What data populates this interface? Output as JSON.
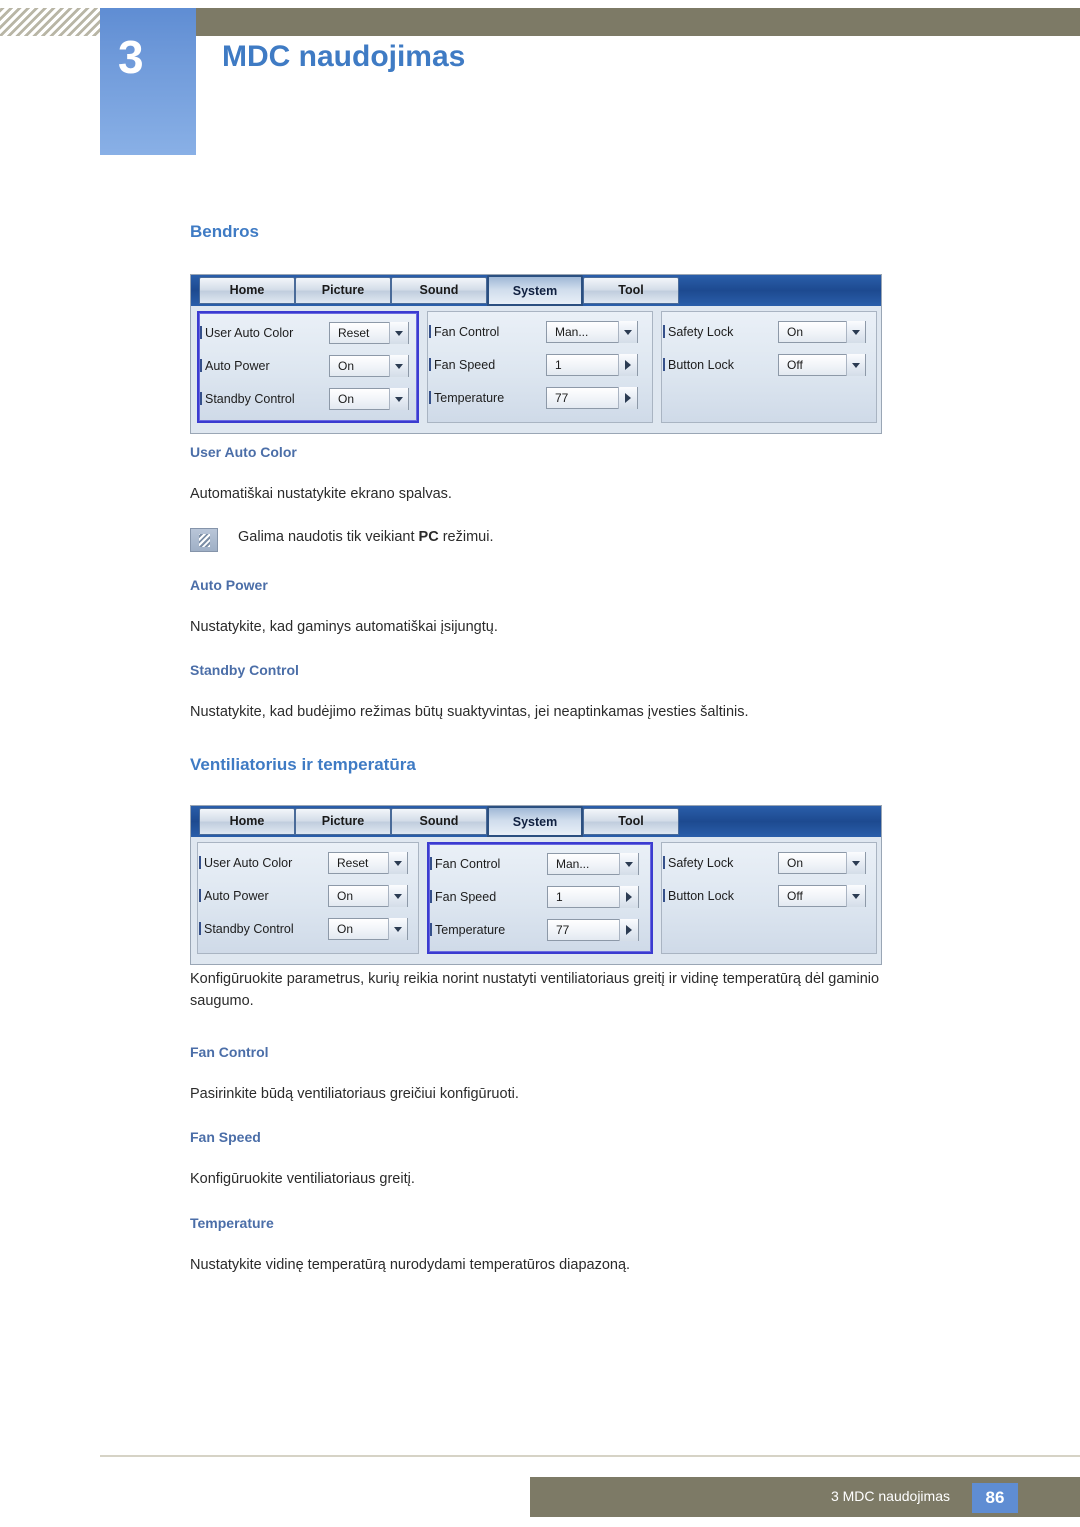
{
  "header": {
    "chapter_number": "3",
    "chapter_title": "MDC naudojimas"
  },
  "sections": [
    {
      "heading": "Bendros",
      "subsections": [
        {
          "title": "User Auto Color",
          "body": "Automatiškai nustatykite ekrano spalvas."
        },
        {
          "title": "Auto Power",
          "body": "Nustatykite, kad gaminys automatiškai įsijungtų."
        },
        {
          "title": "Standby Control",
          "body": "Nustatykite, kad budėjimo režimas būtų suaktyvintas, jei neaptinkamas įvesties šaltinis."
        }
      ],
      "note": {
        "text_before": "Galima naudotis tik veikiant ",
        "bold": "PC",
        "text_after": " režimui.",
        "icon": "note-icon"
      }
    },
    {
      "heading": "Ventiliatorius ir temperatūra",
      "intro": "Konfigūruokite parametrus, kurių reikia norint nustatyti ventiliatoriaus greitį ir vidinę temperatūrą dėl gaminio saugumo.",
      "subsections": [
        {
          "title": "Fan Control",
          "body": "Pasirinkite būdą ventiliatoriaus greičiui konfigūruoti."
        },
        {
          "title": "Fan Speed",
          "body": "Konfigūruokite ventiliatoriaus greitį."
        },
        {
          "title": "Temperature",
          "body": "Nustatykite vidinę temperatūrą nurodydami temperatūros diapazoną."
        }
      ]
    }
  ],
  "panel": {
    "tabs": [
      {
        "label": "Home",
        "active": false
      },
      {
        "label": "Picture",
        "active": false
      },
      {
        "label": "Sound",
        "active": false
      },
      {
        "label": "System",
        "active": true
      },
      {
        "label": "Tool",
        "active": false
      }
    ],
    "group_general": [
      {
        "label": "User Auto Color",
        "value": "Reset",
        "control": "dropdown"
      },
      {
        "label": "Auto Power",
        "value": "On",
        "control": "dropdown"
      },
      {
        "label": "Standby Control",
        "value": "On",
        "control": "dropdown"
      }
    ],
    "group_fan": [
      {
        "label": "Fan Control",
        "value": "Man...",
        "control": "dropdown"
      },
      {
        "label": "Fan Speed",
        "value": "1",
        "control": "spinner"
      },
      {
        "label": "Temperature",
        "value": "77",
        "control": "spinner"
      }
    ],
    "group_lock": [
      {
        "label": "Safety Lock",
        "value": "On",
        "control": "dropdown"
      },
      {
        "label": "Button Lock",
        "value": "Off",
        "control": "dropdown"
      }
    ]
  },
  "footer": {
    "text": "3 MDC naudojimas",
    "page": "86"
  },
  "colors": {
    "accent_blue": "#3f7bc4",
    "sub_heading": "#4b6ea8",
    "header_band": "#7d7a66",
    "selection_border": "#3b3bd0"
  }
}
